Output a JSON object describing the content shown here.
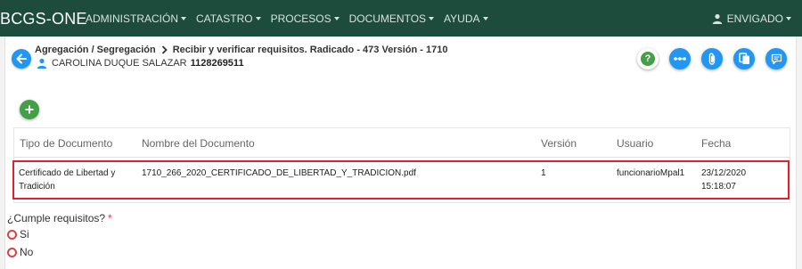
{
  "app": {
    "brand": "BCGS-ONE"
  },
  "nav": {
    "items": [
      {
        "label": "ADMINISTRACIÓN"
      },
      {
        "label": "CATASTRO"
      },
      {
        "label": "PROCESOS"
      },
      {
        "label": "DOCUMENTOS"
      },
      {
        "label": "AYUDA"
      }
    ],
    "user": "ENVIGADO"
  },
  "breadcrumb": {
    "parent": "Agregación / Segregación",
    "current": "Recibir y verificar requisitos. Radicado - 473 Versión - 1710"
  },
  "person": {
    "name": "CAROLINA DUQUE SALAZAR",
    "id": "1128269511"
  },
  "actions": [
    {
      "icon": "help-icon",
      "symbol": "?"
    },
    {
      "icon": "more-icon"
    },
    {
      "icon": "attachment-icon"
    },
    {
      "icon": "copy-document-icon"
    },
    {
      "icon": "notes-icon"
    }
  ],
  "table": {
    "headers": [
      "Tipo de Documento",
      "Nombre del Documento",
      "Versión",
      "Usuario",
      "Fecha"
    ],
    "rows": [
      {
        "tipo_line1": "Certificado de Libertad y",
        "tipo_line2": "Tradición",
        "nombre": "1710_266_2020_CERTIFICADO_DE_LIBERTAD_Y_TRADICION.pdf",
        "version": "1",
        "usuario": "funcionarioMpal1",
        "fecha_date": "23/12/2020",
        "fecha_time": "15:18:07"
      }
    ]
  },
  "form": {
    "question": "¿Cumple requisitos?",
    "required_mark": "*",
    "options": [
      {
        "label": "Si"
      },
      {
        "label": "No"
      }
    ]
  },
  "colors": {
    "navbar": "#1d4b3c",
    "primary": "#2196f3",
    "success": "#43a047",
    "highlight": "#e0222e"
  }
}
